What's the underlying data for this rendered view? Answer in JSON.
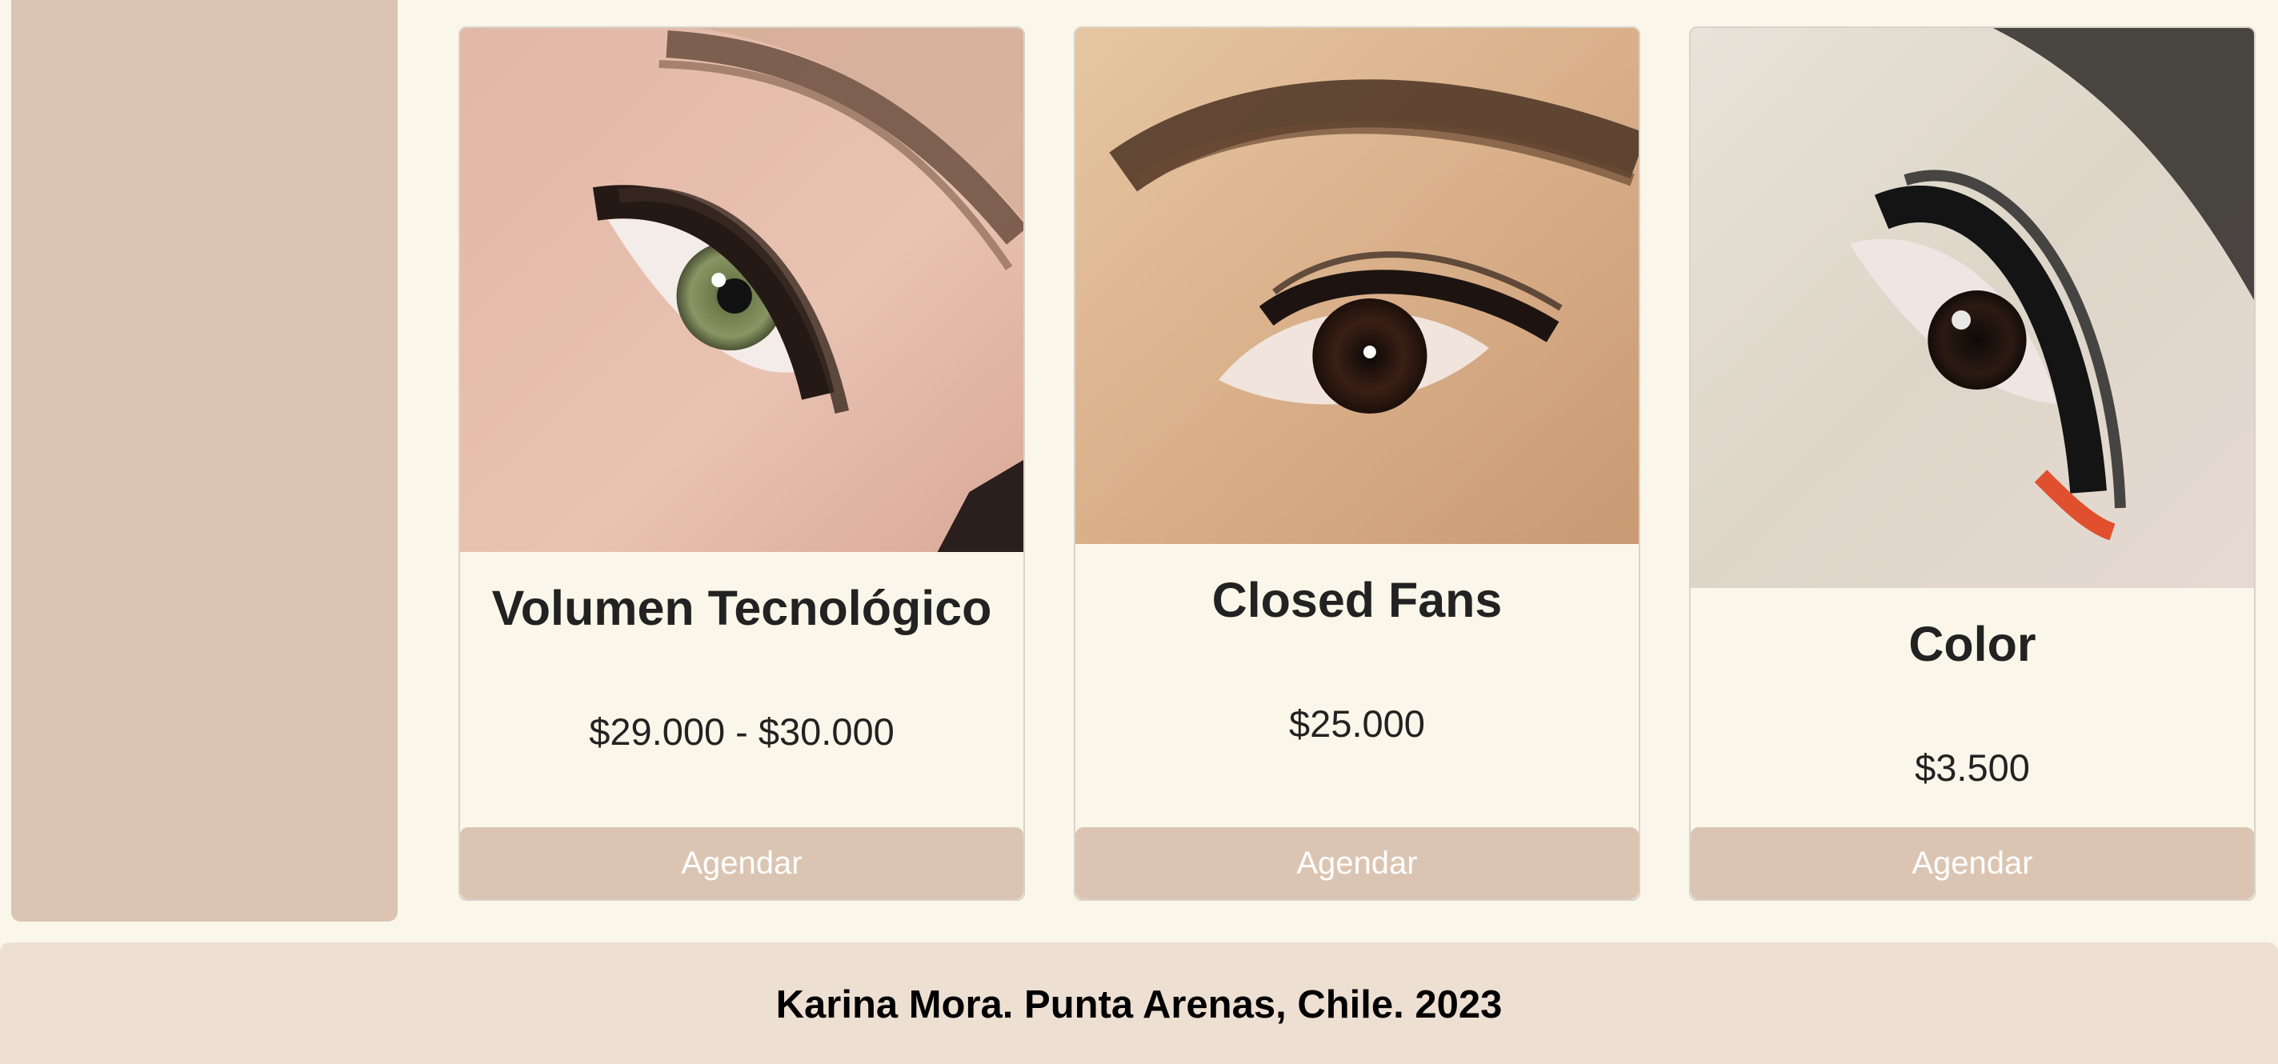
{
  "services": [
    {
      "title": "Volumen Tecnológico",
      "price": "$29.000 - $30.000",
      "button_label": "Agendar",
      "image": "green-eye-volume-lashes"
    },
    {
      "title": "Closed Fans",
      "price": "$25.000",
      "button_label": "Agendar",
      "image": "brown-eye-closed-fans-lashes"
    },
    {
      "title": "Color",
      "price": "$3.500",
      "button_label": "Agendar",
      "image": "eye-color-lashes-red-tips"
    }
  ],
  "footer": {
    "text": "Karina Mora. Punta Arenas, Chile. 2023"
  },
  "colors": {
    "page_background": "#faf7ea",
    "accent": "#dbc5b2",
    "footer_background": "#ede0d3",
    "button_text": "#ffffff"
  }
}
